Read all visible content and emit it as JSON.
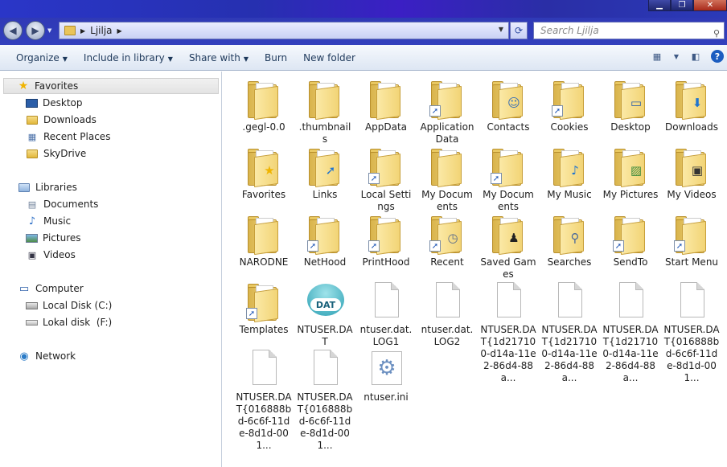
{
  "window": {
    "minimize_label": "▁",
    "maximize_label": "❐",
    "close_label": "✕"
  },
  "address": {
    "crumb": "Ljilja",
    "search_placeholder": "Search Ljilja"
  },
  "toolbar": {
    "organize": "Organize",
    "include_in_library": "Include in library",
    "share_with": "Share with",
    "burn": "Burn",
    "new_folder": "New folder"
  },
  "nav": {
    "favorites": {
      "label": "Favorites",
      "items": [
        "Desktop",
        "Downloads",
        "Recent Places",
        "SkyDrive"
      ]
    },
    "libraries": {
      "label": "Libraries",
      "items": [
        "Documents",
        "Music",
        "Pictures",
        "Videos"
      ]
    },
    "computer": {
      "label": "Computer",
      "items": [
        "Local Disk (C:)",
        "Lokal disk  (F:)"
      ]
    },
    "network": {
      "label": "Network"
    }
  },
  "items": [
    {
      "label": ".gegl-0.0",
      "kind": "folder"
    },
    {
      "label": ".thumbnails",
      "kind": "folder"
    },
    {
      "label": "AppData",
      "kind": "folder"
    },
    {
      "label": "Application Data",
      "kind": "folder",
      "shortcut": true
    },
    {
      "label": "Contacts",
      "kind": "folder",
      "badge": "contacts"
    },
    {
      "label": "Cookies",
      "kind": "folder",
      "shortcut": true
    },
    {
      "label": "Desktop",
      "kind": "folder",
      "badge": "desktop"
    },
    {
      "label": "Downloads",
      "kind": "folder",
      "badge": "download"
    },
    {
      "label": "Favorites",
      "kind": "folder",
      "badge": "star"
    },
    {
      "label": "Links",
      "kind": "folder",
      "badge": "link"
    },
    {
      "label": "Local Settings",
      "kind": "folder",
      "shortcut": true
    },
    {
      "label": "My Documents",
      "kind": "folder"
    },
    {
      "label": "My Documents",
      "kind": "folder",
      "shortcut": true
    },
    {
      "label": "My Music",
      "kind": "folder",
      "badge": "music"
    },
    {
      "label": "My Pictures",
      "kind": "folder",
      "badge": "pictures"
    },
    {
      "label": "My Videos",
      "kind": "folder",
      "badge": "videos"
    },
    {
      "label": "NARODNE",
      "kind": "folder"
    },
    {
      "label": "NetHood",
      "kind": "folder",
      "shortcut": true
    },
    {
      "label": "PrintHood",
      "kind": "folder",
      "shortcut": true
    },
    {
      "label": "Recent",
      "kind": "folder",
      "badge": "clock",
      "shortcut": true
    },
    {
      "label": "Saved Games",
      "kind": "folder",
      "badge": "chess"
    },
    {
      "label": "Searches",
      "kind": "folder",
      "badge": "search"
    },
    {
      "label": "SendTo",
      "kind": "folder",
      "shortcut": true
    },
    {
      "label": "Start Menu",
      "kind": "folder",
      "shortcut": true
    },
    {
      "label": "Templates",
      "kind": "folder",
      "shortcut": true
    },
    {
      "label": "NTUSER.DAT",
      "kind": "dat"
    },
    {
      "label": "ntuser.dat.LOG1",
      "kind": "doc"
    },
    {
      "label": "ntuser.dat.LOG2",
      "kind": "doc"
    },
    {
      "label": "NTUSER.DAT{1d217100-d14a-11e2-86d4-88a...",
      "kind": "doc"
    },
    {
      "label": "NTUSER.DAT{1d217100-d14a-11e2-86d4-88a...",
      "kind": "doc"
    },
    {
      "label": "NTUSER.DAT{1d217100-d14a-11e2-86d4-88a...",
      "kind": "doc"
    },
    {
      "label": "NTUSER.DAT{016888bd-6c6f-11de-8d1d-001...",
      "kind": "doc"
    },
    {
      "label": "NTUSER.DAT{016888bd-6c6f-11de-8d1d-001...",
      "kind": "doc"
    },
    {
      "label": "NTUSER.DAT{016888bd-6c6f-11de-8d1d-001...",
      "kind": "doc"
    },
    {
      "label": "ntuser.ini",
      "kind": "ini"
    }
  ]
}
